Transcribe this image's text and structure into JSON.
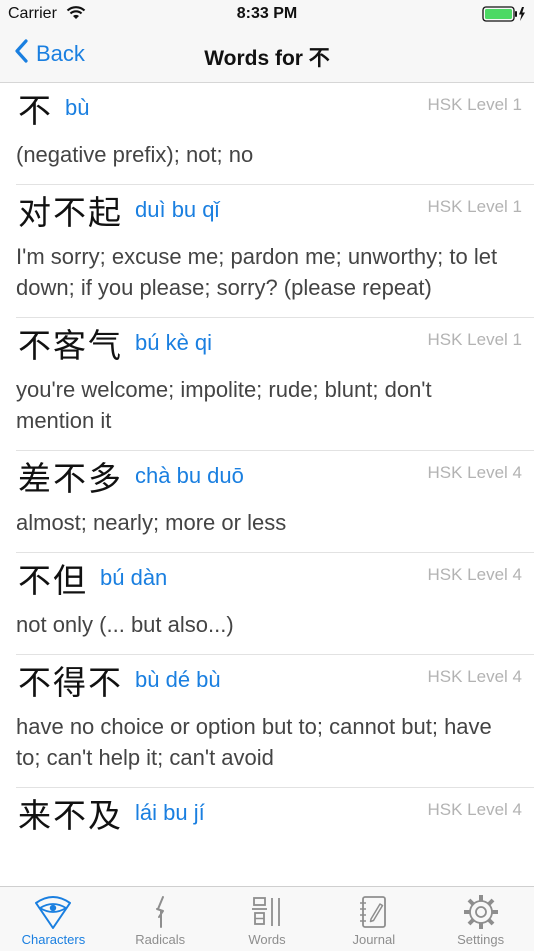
{
  "status": {
    "carrier": "Carrier",
    "time": "8:33 PM"
  },
  "nav": {
    "back_label": "Back",
    "title": "Words for 不"
  },
  "words": [
    {
      "hanzi": "不",
      "pinyin": "bù",
      "level": "HSK Level 1",
      "definition": "(negative prefix); not; no"
    },
    {
      "hanzi": "对不起",
      "pinyin": "duì bu qǐ",
      "level": "HSK Level 1",
      "definition": "I'm sorry; excuse me; pardon me; unworthy; to let down; if you please; sorry? (please repeat)"
    },
    {
      "hanzi": "不客气",
      "pinyin": "bú kè qi",
      "level": "HSK Level 1",
      "definition": "you're welcome; impolite; rude; blunt; don't mention it"
    },
    {
      "hanzi": "差不多",
      "pinyin": "chà bu duō",
      "level": "HSK Level 4",
      "definition": "almost; nearly; more or less"
    },
    {
      "hanzi": "不但",
      "pinyin": "bú dàn",
      "level": "HSK Level 4",
      "definition": "not only (... but also...)"
    },
    {
      "hanzi": "不得不",
      "pinyin": "bù dé bù",
      "level": "HSK Level 4",
      "definition": "have no choice or option but to; cannot but; have to; can't help it; can't avoid"
    },
    {
      "hanzi": "来不及",
      "pinyin": "lái bu jí",
      "level": "HSK Level 4",
      "definition": ""
    }
  ],
  "tabs": [
    {
      "label": "Characters",
      "icon": "characters-eye-icon",
      "active": true
    },
    {
      "label": "Radicals",
      "icon": "radical-stroke-icon",
      "active": false
    },
    {
      "label": "Words",
      "icon": "words-icon",
      "active": false
    },
    {
      "label": "Journal",
      "icon": "journal-notebook-icon",
      "active": false
    },
    {
      "label": "Settings",
      "icon": "settings-gear-icon",
      "active": false
    }
  ],
  "colors": {
    "accent": "#1a7fe0",
    "level_gray": "#b3b3b3",
    "tab_inactive": "#8e8e8e",
    "battery": "#4cd964"
  }
}
